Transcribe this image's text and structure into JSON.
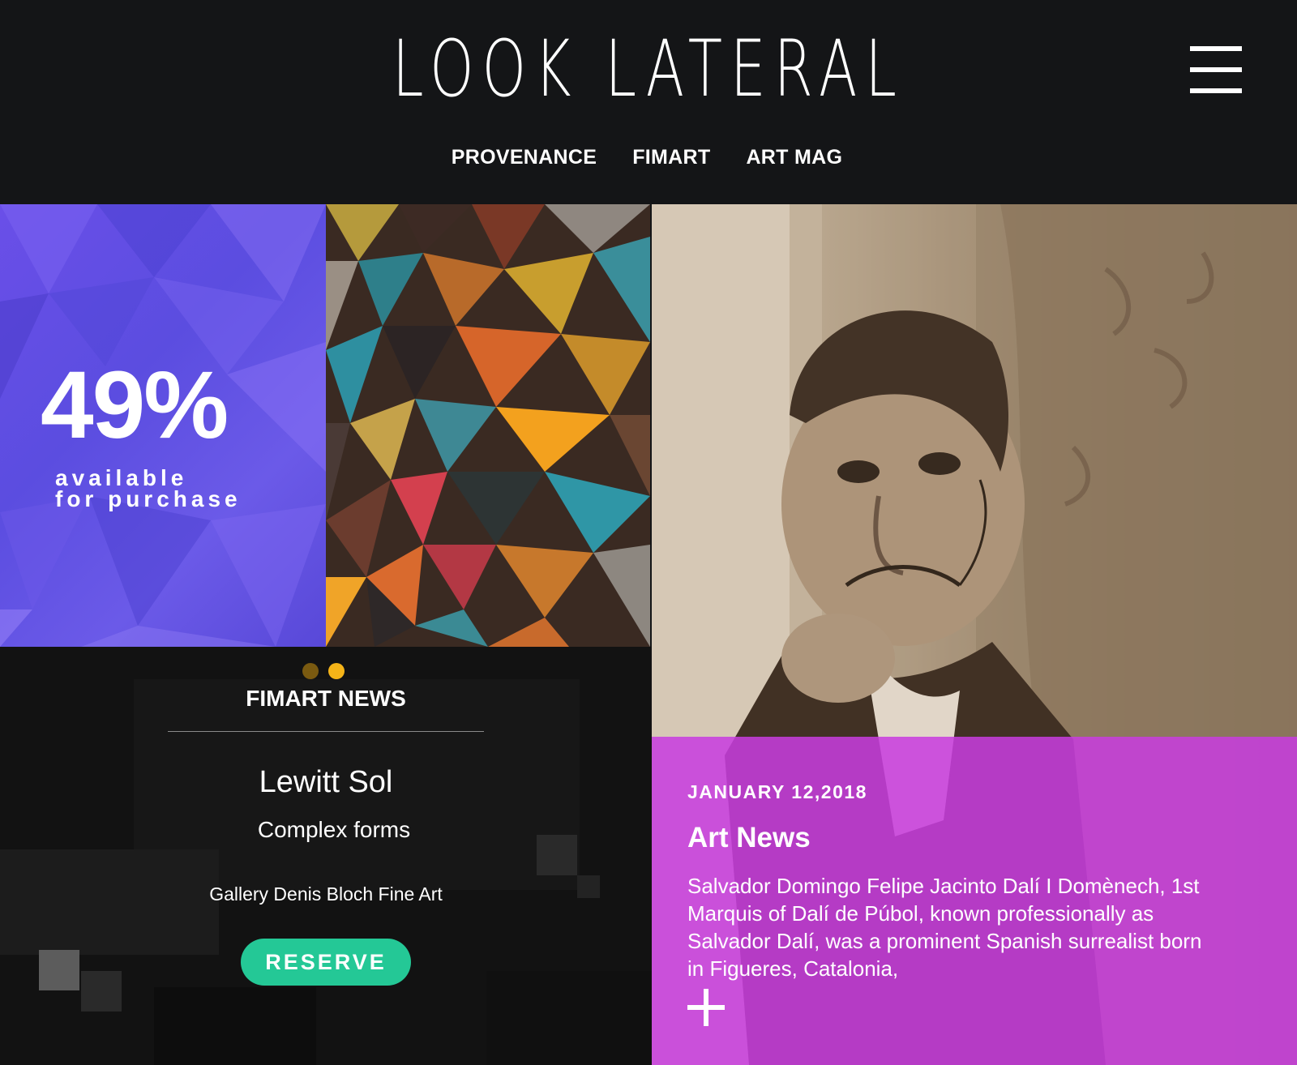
{
  "header": {
    "logo": "LOOK LATERAL",
    "nav": [
      "PROVENANCE",
      "FIMART",
      "ART MAG"
    ],
    "menu_icon": "hamburger-menu-icon"
  },
  "stat": {
    "value": "49%",
    "caption_line1": "available",
    "caption_line2": "for purchase",
    "color": "#5b4de0"
  },
  "news": {
    "slides_total": 2,
    "active_slide": 2,
    "dot_active_color": "#f5b418",
    "dot_inactive_color": "#7a5a10",
    "title": "FIMART NEWS",
    "artist": "Lewitt Sol",
    "work": "Complex forms",
    "gallery": "Gallery Denis Bloch Fine Art",
    "reserve_label": "RESERVE",
    "reserve_color": "#24c896"
  },
  "article": {
    "date": "JANUARY 12,2018",
    "title": "Art News",
    "body": "Salvador Domingo Felipe Jacinto Dalí I Domènech, 1st Marquis of Dalí de Púbol, known professionally as Salvador Dalí, was a prominent Spanish surrealist born in Figueres, Catalonia,",
    "expand_icon": "plus-icon",
    "panel_color": "#c83ce0"
  }
}
